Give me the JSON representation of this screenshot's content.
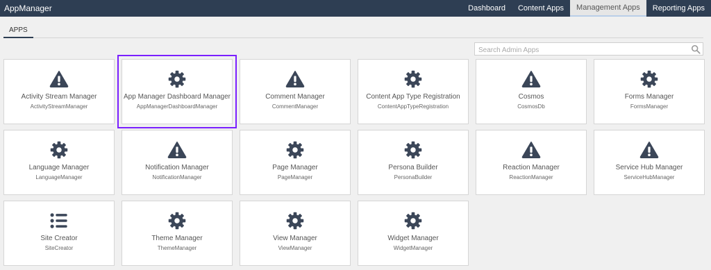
{
  "header": {
    "brand": "AppManager",
    "nav": [
      {
        "label": "Dashboard"
      },
      {
        "label": "Content Apps"
      },
      {
        "label": "Management Apps"
      },
      {
        "label": "Reporting Apps"
      }
    ]
  },
  "tabs": [
    {
      "label": "APPS"
    }
  ],
  "search": {
    "placeholder": "Search Admin Apps"
  },
  "apps": [
    {
      "title": "Activity Stream Manager",
      "subtitle": "ActivityStreamManager",
      "icon": "warning-icon"
    },
    {
      "title": "App Manager Dashboard Manager",
      "subtitle": "AppManagerDashboardManager",
      "icon": "gear-icon"
    },
    {
      "title": "Comment Manager",
      "subtitle": "CommentManager",
      "icon": "warning-icon"
    },
    {
      "title": "Content App Type Registration",
      "subtitle": "ContentAppTypeRegistration",
      "icon": "gear-icon"
    },
    {
      "title": "Cosmos",
      "subtitle": "CosmosDb",
      "icon": "warning-icon"
    },
    {
      "title": "Forms Manager",
      "subtitle": "FormsManager",
      "icon": "gear-icon"
    },
    {
      "title": "Language Manager",
      "subtitle": "LanguageManager",
      "icon": "gear-icon"
    },
    {
      "title": "Notification Manager",
      "subtitle": "NotificationManager",
      "icon": "warning-icon"
    },
    {
      "title": "Page Manager",
      "subtitle": "PageManager",
      "icon": "gear-icon"
    },
    {
      "title": "Persona Builder",
      "subtitle": "PersonaBuilder",
      "icon": "gear-icon"
    },
    {
      "title": "Reaction Manager",
      "subtitle": "ReactionManager",
      "icon": "warning-icon"
    },
    {
      "title": "Service Hub Manager",
      "subtitle": "ServiceHubManager",
      "icon": "warning-icon"
    },
    {
      "title": "Site Creator",
      "subtitle": "SiteCreator",
      "icon": "list-icon"
    },
    {
      "title": "Theme Manager",
      "subtitle": "ThemeManager",
      "icon": "gear-icon"
    },
    {
      "title": "View Manager",
      "subtitle": "ViewManager",
      "icon": "gear-icon"
    },
    {
      "title": "Widget Manager",
      "subtitle": "WidgetManager",
      "icon": "gear-icon"
    }
  ],
  "colors": {
    "header_bg": "#2e3e53",
    "icon": "#3b4658",
    "selection": "#7a1fff"
  }
}
